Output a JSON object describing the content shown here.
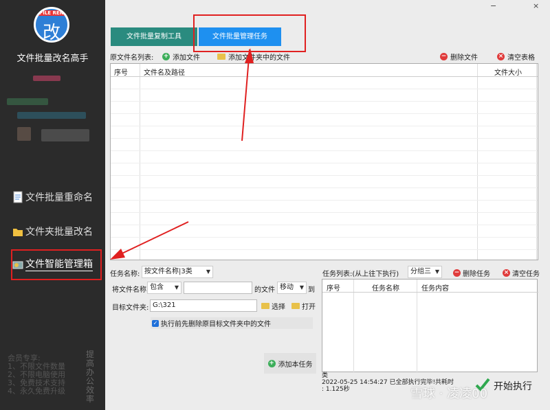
{
  "app": {
    "logo_top": "FILE REN",
    "logo_char": "改",
    "title": "文件批量改名高手"
  },
  "sidebar": {
    "items": [
      {
        "label": "文件批量重命名"
      },
      {
        "label": "文件夹批量改名"
      },
      {
        "label": "文件智能管理箱"
      }
    ],
    "member_lines": [
      "会员专享:",
      "1、不限文件数量",
      "2、不限电脑使用",
      "3、免费技术支持",
      "4、永久免费升级"
    ],
    "vertical_text": "提高办公效率"
  },
  "window": {
    "minimize": "−",
    "close": "×"
  },
  "tabs": [
    {
      "label": "文件批量复制工具"
    },
    {
      "label": "文件批量管理任务"
    }
  ],
  "file_toolbar": {
    "list_label": "原文件名列表:",
    "add_file": "添加文件",
    "add_folder_files": "添加文件夹中的文件",
    "delete_file": "删除文件",
    "clear_table": "清空表格"
  },
  "file_table": {
    "columns": [
      "序号",
      "文件名及路径",
      "文件大小"
    ]
  },
  "form": {
    "task_name_label": "任务名称:",
    "task_name_value": "按文件名称|3类",
    "rename_label": "将文件名称",
    "contains_value": "包含",
    "keyword_value": "",
    "file_label": "的文件",
    "move_value": "移动",
    "to_label": "到",
    "target_label": "目标文件夹:",
    "target_value": "G:\\321",
    "choose": "选择",
    "open": "打开",
    "checkbox_label": "执行前先删除原目标文件夹中的文件",
    "add_task": "添加本任务"
  },
  "task_panel": {
    "list_label": "任务列表:(从上往下执行)",
    "group_value": "分组三",
    "delete_task": "删除任务",
    "clear_task": "清空任务",
    "columns": [
      "序号",
      "任务名称",
      "任务内容"
    ],
    "status_lines": [
      "类",
      "2022-05-25 14:54:27 已全部执行完毕!共耗时",
      ": 1.125秒"
    ],
    "start": "开始执行"
  },
  "watermark": "雪球 · 凌凌00"
}
